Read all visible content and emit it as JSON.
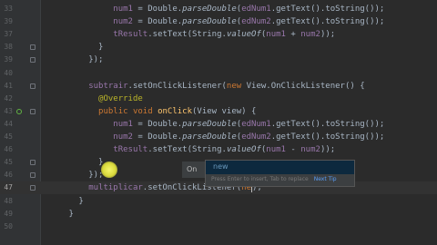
{
  "editor": {
    "lines": [
      {
        "num": "33",
        "indent": 15,
        "segments": [
          {
            "t": "num1",
            "c": "fld"
          },
          {
            "t": " = Double.",
            "c": "plain"
          },
          {
            "t": "parseDouble",
            "c": "plain it"
          },
          {
            "t": "(",
            "c": "plain"
          },
          {
            "t": "edNum1",
            "c": "fld"
          },
          {
            "t": ".getText().toString());",
            "c": "plain"
          }
        ]
      },
      {
        "num": "39",
        "indent": 15,
        "segments": [
          {
            "t": "num2",
            "c": "fld"
          },
          {
            "t": " = Double.",
            "c": "plain"
          },
          {
            "t": "parseDouble",
            "c": "plain it"
          },
          {
            "t": "(",
            "c": "plain"
          },
          {
            "t": "edNum2",
            "c": "fld"
          },
          {
            "t": ".getText().toString());",
            "c": "plain"
          }
        ]
      },
      {
        "num": "37",
        "indent": 15,
        "segments": [
          {
            "t": "tResult",
            "c": "fld"
          },
          {
            "t": ".setText(String.",
            "c": "plain"
          },
          {
            "t": "valueOf",
            "c": "plain it"
          },
          {
            "t": "(",
            "c": "plain"
          },
          {
            "t": "num1",
            "c": "fld"
          },
          {
            "t": " + ",
            "c": "plain"
          },
          {
            "t": "num2",
            "c": "fld"
          },
          {
            "t": "));",
            "c": "plain"
          }
        ]
      },
      {
        "num": "38",
        "indent": 12,
        "segments": [
          {
            "t": "}",
            "c": "plain"
          }
        ]
      },
      {
        "num": "39",
        "indent": 10,
        "segments": [
          {
            "t": "});",
            "c": "plain"
          }
        ]
      },
      {
        "num": "40",
        "indent": 0,
        "segments": []
      },
      {
        "num": "41",
        "indent": 10,
        "segments": [
          {
            "t": "subtrair",
            "c": "fld"
          },
          {
            "t": ".setOnClickListener(",
            "c": "plain"
          },
          {
            "t": "new ",
            "c": "kw"
          },
          {
            "t": "View.OnClickListener() {",
            "c": "plain"
          }
        ]
      },
      {
        "num": "42",
        "indent": 12,
        "segments": [
          {
            "t": "@Override",
            "c": "ann"
          }
        ]
      },
      {
        "num": "43",
        "indent": 12,
        "segments": [
          {
            "t": "public void ",
            "c": "kw"
          },
          {
            "t": "onClick",
            "c": "fn"
          },
          {
            "t": "(View view) {",
            "c": "plain"
          }
        ]
      },
      {
        "num": "44",
        "indent": 15,
        "segments": [
          {
            "t": "num1",
            "c": "fld"
          },
          {
            "t": " = Double.",
            "c": "plain"
          },
          {
            "t": "parseDouble",
            "c": "plain it"
          },
          {
            "t": "(",
            "c": "plain"
          },
          {
            "t": "edNum1",
            "c": "fld"
          },
          {
            "t": ".getText().toString());",
            "c": "plain"
          }
        ]
      },
      {
        "num": "45",
        "indent": 15,
        "segments": [
          {
            "t": "num2",
            "c": "fld"
          },
          {
            "t": " = Double.",
            "c": "plain"
          },
          {
            "t": "parseDouble",
            "c": "plain it"
          },
          {
            "t": "(",
            "c": "plain"
          },
          {
            "t": "edNum2",
            "c": "fld"
          },
          {
            "t": ".getText().toString());",
            "c": "plain"
          }
        ]
      },
      {
        "num": "46",
        "indent": 15,
        "segments": [
          {
            "t": "tResult",
            "c": "fld"
          },
          {
            "t": ".setText(String.",
            "c": "plain"
          },
          {
            "t": "valueOf",
            "c": "plain it"
          },
          {
            "t": "(",
            "c": "plain"
          },
          {
            "t": "num1",
            "c": "fld"
          },
          {
            "t": " - ",
            "c": "plain"
          },
          {
            "t": "num2",
            "c": "fld"
          },
          {
            "t": "));",
            "c": "plain"
          }
        ]
      },
      {
        "num": "45",
        "indent": 12,
        "segments": [
          {
            "t": "}",
            "c": "plain"
          }
        ]
      },
      {
        "num": "46",
        "indent": 10,
        "segments": [
          {
            "t": "});",
            "c": "plain"
          }
        ]
      },
      {
        "num": "47",
        "indent": 10,
        "current": true,
        "segments": [
          {
            "t": "multiplicar",
            "c": "fld"
          },
          {
            "t": ".setOnClickListener(",
            "c": "plain"
          },
          {
            "t": "ne",
            "c": "kw"
          },
          {
            "t": "CARET",
            "c": "caret"
          },
          {
            "t": ");",
            "c": "plain"
          }
        ]
      },
      {
        "num": "48",
        "indent": 8,
        "segments": [
          {
            "t": "}",
            "c": "plain"
          }
        ]
      },
      {
        "num": "49",
        "indent": 6,
        "segments": [
          {
            "t": "}",
            "c": "plain"
          }
        ]
      },
      {
        "num": "50",
        "indent": 0,
        "segments": []
      }
    ]
  },
  "autocomplete": {
    "tooltip_text": "On",
    "items": [
      {
        "label": "new"
      }
    ],
    "hint": "Press Enter to insert, Tab to replace",
    "next_tip": "Next Tip"
  }
}
